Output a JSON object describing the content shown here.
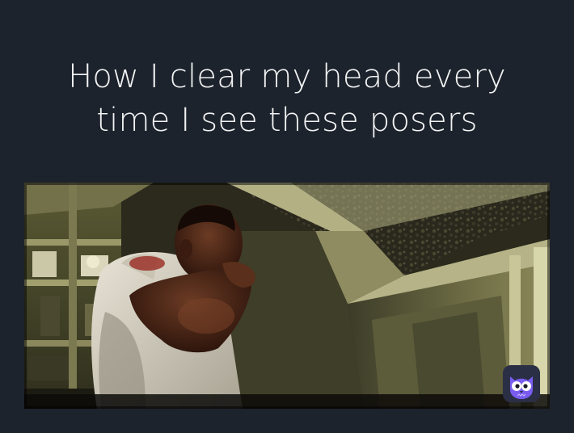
{
  "caption": {
    "text": "How I clear my head every\ntime I see these posers"
  },
  "colors": {
    "background": "#1c232d",
    "caption_text": "#f2f2f2",
    "badge_background": "#2a2f45",
    "badge_owl": "#7a5cf0"
  },
  "photo": {
    "description_icon": "video-still"
  },
  "badge": {
    "icon": "owl-icon"
  }
}
